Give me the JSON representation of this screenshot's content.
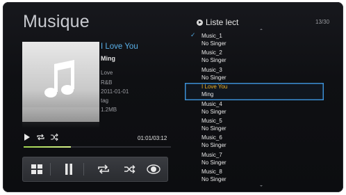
{
  "app": {
    "title": "Musique"
  },
  "now_playing": {
    "title": "I Love You",
    "artist": "Ming",
    "genre_line1": "Love",
    "genre_line2": "R&B",
    "date": "2011-01-01",
    "tag": "tag",
    "size": "1.2MB",
    "time": "01:01/03:12",
    "progress_fraction": 0.32
  },
  "playlist": {
    "title": "Liste lect",
    "count": "13/30",
    "items": [
      {
        "name": "Music_1",
        "artist": "No Singer",
        "playing": true,
        "selected": false
      },
      {
        "name": "Music_2",
        "artist": "No Singer",
        "playing": false,
        "selected": false
      },
      {
        "name": "Music_3",
        "artist": "No Singer",
        "playing": false,
        "selected": false
      },
      {
        "name": "I Love You",
        "artist": "Ming",
        "playing": false,
        "selected": true
      },
      {
        "name": "Music_4",
        "artist": "No Singer",
        "playing": false,
        "selected": false
      },
      {
        "name": "Music_5",
        "artist": "No Singer",
        "playing": false,
        "selected": false
      },
      {
        "name": "Music_6",
        "artist": "No Singer",
        "playing": false,
        "selected": false
      },
      {
        "name": "Music_7",
        "artist": "No Singer",
        "playing": false,
        "selected": false
      },
      {
        "name": "Music_8",
        "artist": "No Singer",
        "playing": false,
        "selected": false
      }
    ]
  },
  "icons": {
    "album_art": "music-note-icon",
    "status": [
      "play-status-icon",
      "repeat-status-icon",
      "shuffle-status-icon"
    ],
    "controls": [
      "grid-menu-icon",
      "pause-icon",
      "repeat-icon",
      "shuffle-icon",
      "sound-mode-icon"
    ]
  },
  "colors": {
    "accent_blue": "#5ab1ea",
    "highlight_orange": "#f0b429",
    "progress_green": "#9fd34f",
    "background": "#0f1013"
  }
}
